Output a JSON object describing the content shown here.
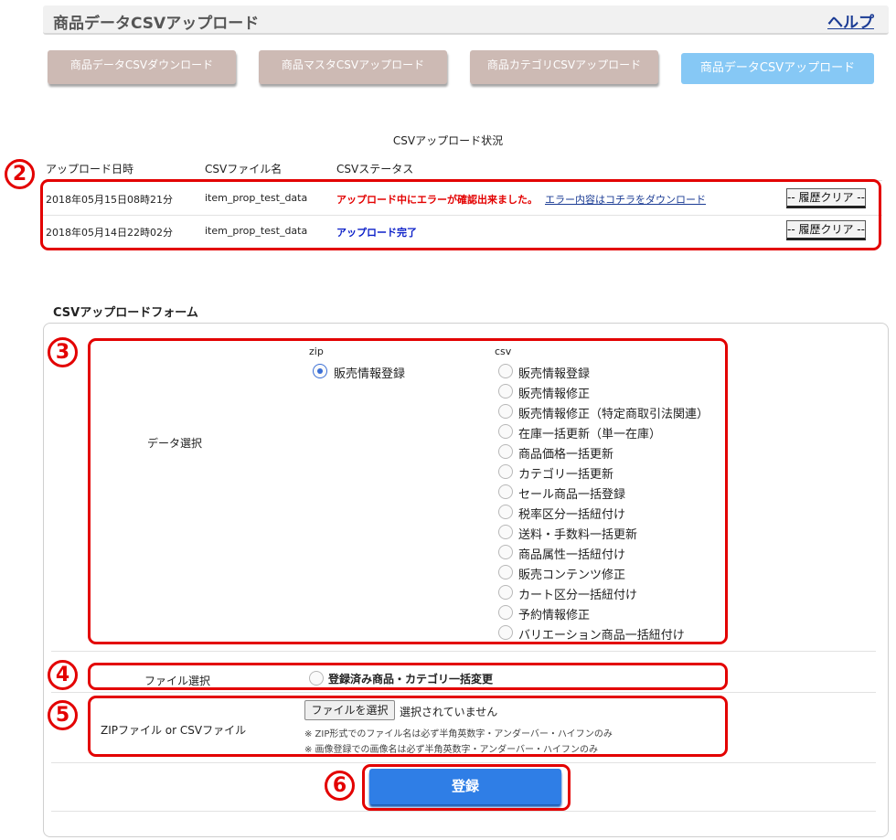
{
  "header": {
    "title": "商品データCSVアップロード",
    "help": "ヘルプ"
  },
  "tabs": [
    {
      "label": "商品データCSVダウンロード"
    },
    {
      "label": "商品マスタCSVアップロード"
    },
    {
      "label": "商品カテゴリCSVアップロード"
    },
    {
      "label": "商品データCSVアップロード"
    }
  ],
  "status": {
    "title": "CSVアップロード状況",
    "columns": [
      "アップロード日時",
      "CSVファイル名",
      "CSVステータス"
    ],
    "rows": [
      {
        "datetime": "2018年05月15日08時21分",
        "filename": "item_prop_test_data",
        "status": "アップロード中にエラーが確認出来ました。",
        "link": "エラー内容はコチラをダウンロード",
        "clear": "-- 履歴クリア --"
      },
      {
        "datetime": "2018年05月14日22時02分",
        "filename": "item_prop_test_data",
        "status": "アップロード完了",
        "clear": "-- 履歴クリア --"
      }
    ]
  },
  "form": {
    "title": "CSVアップロードフォーム",
    "data_select_label": "データ選択",
    "zip_header": "zip",
    "csv_header": "csv",
    "zip_option": "販売情報登録",
    "csv_options": [
      "販売情報登録",
      "販売情報修正",
      "販売情報修正（特定商取引法関連）",
      "在庫一括更新（単一在庫）",
      "商品価格一括更新",
      "カテゴリ一括更新",
      "セール商品一括登録",
      "税率区分一括紐付け",
      "送料・手数料一括更新",
      "商品属性一括紐付け",
      "販売コンテンツ修正",
      "カート区分一括紐付け",
      "予約情報修正",
      "バリエーション商品一括紐付け"
    ],
    "file_select_label": "ファイル選択",
    "file_select_option": "登録済み商品・カテゴリ一括変更",
    "upload_label": "ZIPファイル or CSVファイル",
    "choose_file": "ファイルを選択",
    "no_file": "選択されていません",
    "note1": "※ ZIP形式でのファイル名は必ず半角英数字・アンダーバー・ハイフンのみ",
    "note2": "※ 画像登録での画像名は必ず半角英数字・アンダーバー・ハイフンのみ",
    "submit": "登録"
  },
  "annotations": [
    "2",
    "3",
    "4",
    "5",
    "6"
  ],
  "colors": {
    "accent": "#2f7ee6",
    "annotation": "#e30000",
    "tab_inactive": "#cdbab4",
    "tab_active": "#86c8f5"
  }
}
